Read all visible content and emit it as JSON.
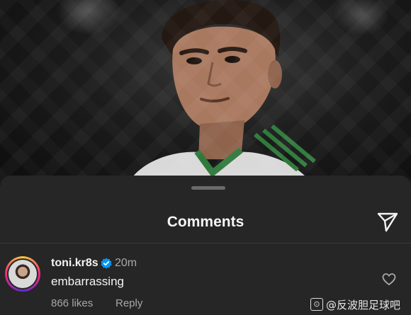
{
  "sheet": {
    "title": "Comments"
  },
  "comment": {
    "username": "toni.kr8s",
    "verified": true,
    "time": "20m",
    "text": "embarrassing",
    "likes": "866 likes",
    "reply_label": "Reply"
  },
  "watermark": {
    "logo_glyph": "⊙",
    "text": "@反波胆足球吧"
  },
  "colors": {
    "sheet_bg": "#262626",
    "verified_blue": "#0095f6"
  }
}
